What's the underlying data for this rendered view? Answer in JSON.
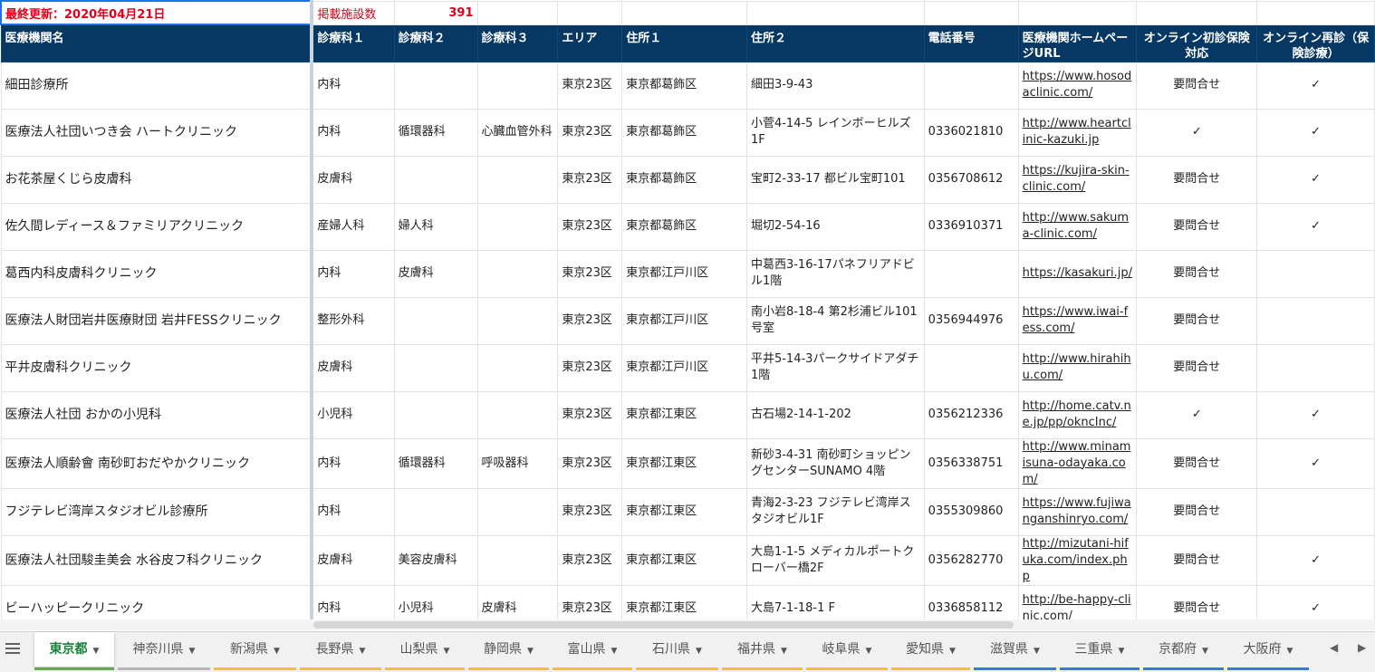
{
  "top": {
    "updated": "最終更新：2020年04月21日",
    "count_label": "掲載施設数",
    "count_value": "391"
  },
  "headers": [
    "医療機関名",
    "診療科１",
    "診療科２",
    "診療科３",
    "エリア",
    "住所１",
    "住所２",
    "電話番号",
    "医療機関ホームページURL",
    "オンライン初診保険対応",
    "オンライン再診（保険診療）"
  ],
  "rows": [
    {
      "name": "細田診療所",
      "d1": "内科",
      "d2": "",
      "d3": "",
      "area": "東京23区",
      "addr1": "東京都葛飾区",
      "addr2": "細田3-9-43",
      "tel": "",
      "url": "https://www.hosodaclinic.com/",
      "first": "要問合せ",
      "re": "✓"
    },
    {
      "name": "医療法人社団いつき会 ハートクリニック",
      "d1": "内科",
      "d2": "循環器科",
      "d3": "心臓血管外科",
      "area": "東京23区",
      "addr1": "東京都葛飾区",
      "addr2": "小菅4-14-5 レインボーヒルズ1F",
      "tel": "0336021810",
      "url": "http://www.heartclinic-kazuki.jp",
      "first": "✓",
      "re": "✓"
    },
    {
      "name": "お花茶屋くじら皮膚科",
      "d1": "皮膚科",
      "d2": "",
      "d3": "",
      "area": "東京23区",
      "addr1": "東京都葛飾区",
      "addr2": "宝町2-33-17 都ビル宝町101",
      "tel": "0356708612",
      "url": "https://kujira-skin-clinic.com/",
      "first": "要問合せ",
      "re": "✓"
    },
    {
      "name": "佐久間レディース＆ファミリアクリニック",
      "d1": "産婦人科",
      "d2": "婦人科",
      "d3": "",
      "area": "東京23区",
      "addr1": "東京都葛飾区",
      "addr2": "堀切2-54-16",
      "tel": "0336910371",
      "url": "http://www.sakuma-clinic.com/",
      "first": "要問合せ",
      "re": "✓"
    },
    {
      "name": "葛西内科皮膚科クリニック",
      "d1": "内科",
      "d2": "皮膚科",
      "d3": "",
      "area": "東京23区",
      "addr1": "東京都江戸川区",
      "addr2": "中葛西3-16-17パネフリアドビル1階",
      "tel": "",
      "url": "https://kasakuri.jp/",
      "first": "要問合せ",
      "re": ""
    },
    {
      "name": "医療法人財団岩井医療財団 岩井FESSクリニック",
      "d1": "整形外科",
      "d2": "",
      "d3": "",
      "area": "東京23区",
      "addr1": "東京都江戸川区",
      "addr2": "南小岩8-18-4 第2杉浦ビル101号室",
      "tel": "0356944976",
      "url": "https://www.iwai-fess.com/",
      "first": "要問合せ",
      "re": ""
    },
    {
      "name": "平井皮膚科クリニック",
      "d1": "皮膚科",
      "d2": "",
      "d3": "",
      "area": "東京23区",
      "addr1": "東京都江戸川区",
      "addr2": "平井5-14-3パークサイドアダチ1階",
      "tel": "",
      "url": "http://www.hirahihu.com/",
      "first": "要問合せ",
      "re": ""
    },
    {
      "name": "医療法人社団 おかの小児科",
      "d1": "小児科",
      "d2": "",
      "d3": "",
      "area": "東京23区",
      "addr1": "東京都江東区",
      "addr2": "古石場2-14-1-202",
      "tel": "0356212336",
      "url": "http://home.catv.ne.jp/pp/okncInc/",
      "first": "✓",
      "re": "✓"
    },
    {
      "name": "医療法人順齢會 南砂町おだやかクリニック",
      "d1": "内科",
      "d2": "循環器科",
      "d3": "呼吸器科",
      "area": "東京23区",
      "addr1": "東京都江東区",
      "addr2": "新砂3-4-31 南砂町ショッピングセンターSUNAMO 4階",
      "tel": "0356338751",
      "url": "http://www.minamisuna-odayaka.com/",
      "first": "要問合せ",
      "re": "✓"
    },
    {
      "name": "フジテレビ湾岸スタジオビル診療所",
      "d1": "内科",
      "d2": "",
      "d3": "",
      "area": "東京23区",
      "addr1": "東京都江東区",
      "addr2": "青海2-3-23 フジテレビ湾岸スタジオビル1F",
      "tel": "0355309860",
      "url": "https://www.fujiwanganshinryo.com/",
      "first": "要問合せ",
      "re": ""
    },
    {
      "name": "医療法人社団駿圭美会 水谷皮フ科クリニック",
      "d1": "皮膚科",
      "d2": "美容皮膚科",
      "d3": "",
      "area": "東京23区",
      "addr1": "東京都江東区",
      "addr2": "大島1-1-5 メディカルポートクローバー橋2F",
      "tel": "0356282770",
      "url": "http://mizutani-hifuka.com/index.php",
      "first": "要問合せ",
      "re": "✓"
    },
    {
      "name": "ビーハッピークリニック",
      "d1": "内科",
      "d2": "小児科",
      "d3": "皮膚科",
      "area": "東京23区",
      "addr1": "東京都江東区",
      "addr2": "大島7-1-18-1 F",
      "tel": "0336858112",
      "url": "http://be-happy-clinic.com/",
      "first": "要問合せ",
      "re": "✓"
    }
  ],
  "tabs": [
    "東京都",
    "神奈川県",
    "新潟県",
    "長野県",
    "山梨県",
    "静岡県",
    "富山県",
    "石川県",
    "福井県",
    "岐阜県",
    "愛知県",
    "滋賀県",
    "三重県",
    "京都府",
    "大阪府"
  ],
  "tab_colors": [
    "#6aa84f",
    "#b7b7b7",
    "#f1c232",
    "#f1c232",
    "#f1c232",
    "#f1c232",
    "#f1c232",
    "#f1c232",
    "#f1c232",
    "#f1c232",
    "#f1c232",
    "#3c78d8",
    "#3c78d8",
    "#3c78d8",
    "#3c78d8"
  ],
  "icons": {
    "menu": "menu-icon",
    "prev": "chevron-left-icon",
    "next": "chevron-right-icon",
    "check": "check-icon"
  }
}
